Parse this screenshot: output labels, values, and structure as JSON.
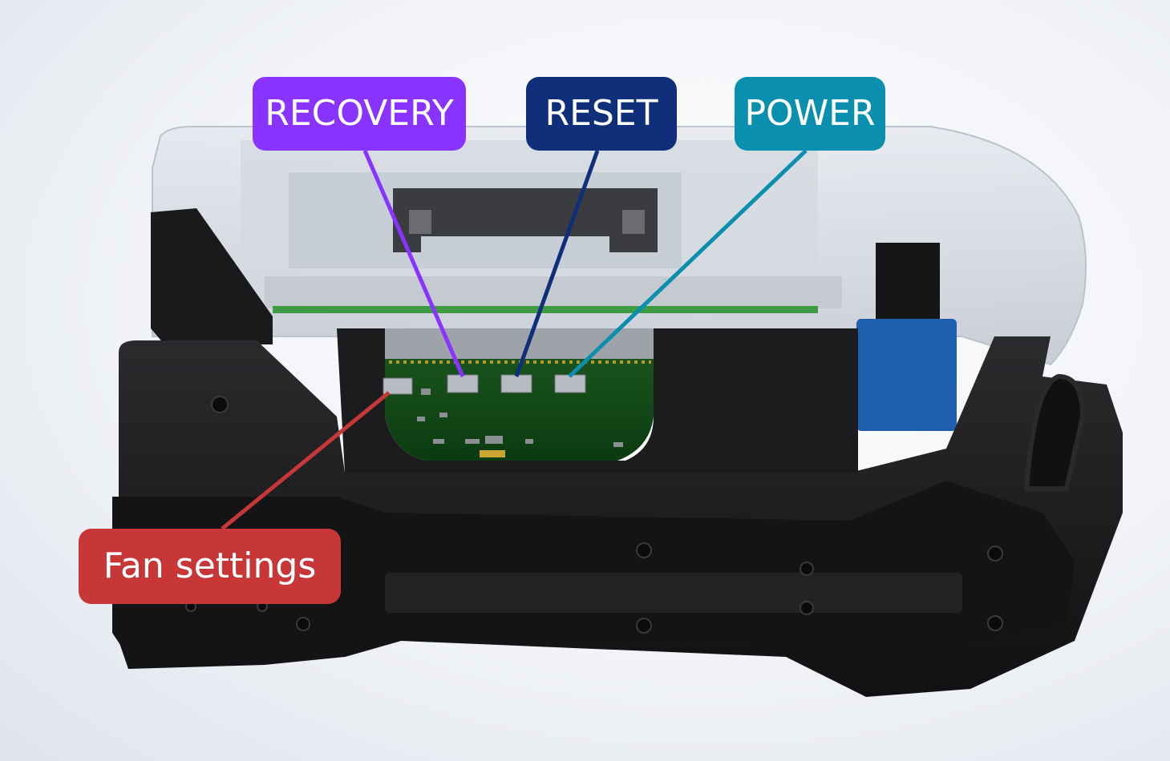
{
  "labels": {
    "recovery": "RECOVERY",
    "reset": "RESET",
    "power": "POWER",
    "fan": "Fan settings"
  },
  "colors": {
    "recovery": "#8833ff",
    "reset": "#0f2f7a",
    "power": "#0a8fae",
    "fan": "#c73737",
    "housing": "#1d1d1f",
    "pcb": "#0f4a14",
    "shell": "#c9ced8"
  }
}
